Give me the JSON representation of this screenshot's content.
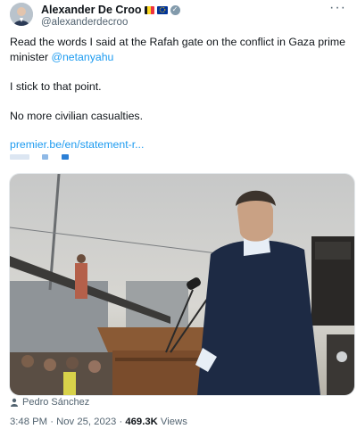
{
  "author": {
    "display_name": "Alexander De Croo",
    "handle": "@alexanderdecroo",
    "flags": [
      "belgium-flag",
      "eu-flag"
    ],
    "verified_badge": "gray-check-icon"
  },
  "menu": {
    "more_label": "···"
  },
  "tweet": {
    "line1_before": "Read the words I said at the Rafah gate on the conflict in Gaza prime minister ",
    "mention": "@netanyahu",
    "line2": "I stick to that point.",
    "line3": "No more civilian casualties.",
    "link": "premier.be/en/statement-r..."
  },
  "media": {
    "alt_subject": "speech-at-podium-photo",
    "caption_icon": "person-icon",
    "caption": "Pedro Sánchez"
  },
  "meta": {
    "time_date": "3:48 PM · Nov 25, 2023 · ",
    "views_count": "469.3K",
    "views_label": " Views"
  },
  "colors": {
    "link_blue": "#1d9bf0",
    "muted_gray": "#536471",
    "text": "#0f1419"
  }
}
